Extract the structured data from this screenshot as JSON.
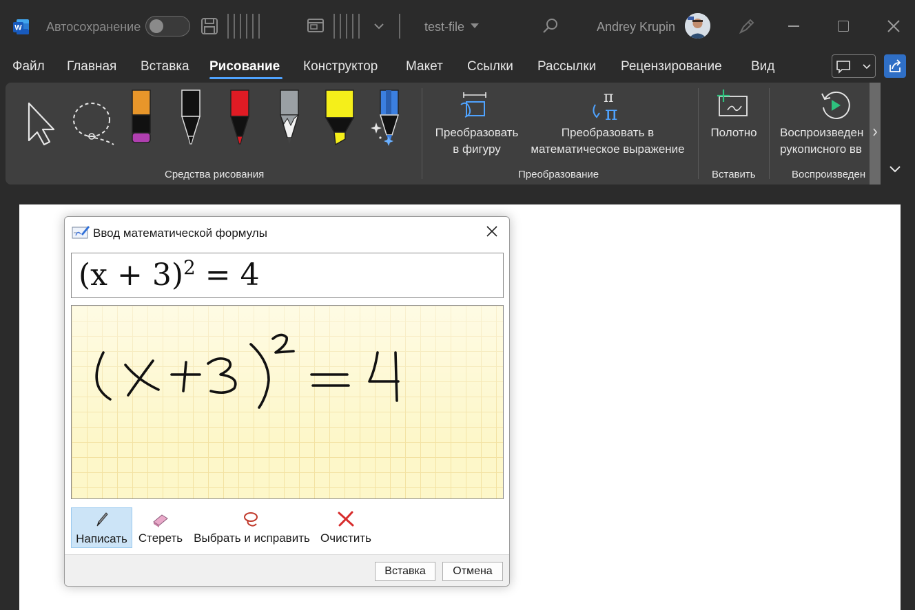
{
  "titlebar": {
    "autosave_label": "Автосохранение",
    "autosave_on": false,
    "filename": "test-file",
    "username": "Andrey Krupin"
  },
  "tabs": [
    {
      "label": "Файл"
    },
    {
      "label": "Главная"
    },
    {
      "label": "Вставка"
    },
    {
      "label": "Рисование",
      "active": true
    },
    {
      "label": "Конструктор"
    },
    {
      "label": "Макет"
    },
    {
      "label": "Ссылки"
    },
    {
      "label": "Рассылки"
    },
    {
      "label": "Рецензирование"
    },
    {
      "label": "Вид"
    }
  ],
  "ribbon": {
    "groups": {
      "drawing_tools": "Средства рисования",
      "convert": "Преобразование",
      "insert": "Вставить",
      "replay": "Воспроизведен"
    },
    "buttons": {
      "to_shape_line1": "Преобразовать",
      "to_shape_line2": "в фигуру",
      "to_math_line1": "Преобразовать в",
      "to_math_line2": "математическое выражение",
      "canvas": "Полотно",
      "replay_line1": "Воспроизведен",
      "replay_line2": "рукописного вв"
    },
    "pens": [
      {
        "name": "orange-pen",
        "color": "#e8962a",
        "tip": "#b03fb0"
      },
      {
        "name": "black-pen",
        "color": "#111111",
        "tip": "#111111"
      },
      {
        "name": "red-pen",
        "color": "#e01b24",
        "tip": "#e01b24"
      },
      {
        "name": "pencil",
        "color": "#9aa0a4",
        "tip": "#444444"
      },
      {
        "name": "yellow-highlighter",
        "color": "#f5ef1a",
        "tip": "#f5ef1a"
      },
      {
        "name": "action-pen",
        "color": "#3b7fe0",
        "tip": "#3b7fe0"
      }
    ],
    "accent": "#4fa3ff"
  },
  "dialog": {
    "title": "Ввод математической формулы",
    "preview": {
      "base": "(x + 3)",
      "exponent": "2",
      "rhs": " = 4"
    },
    "tools": [
      {
        "label": "Написать",
        "active": true
      },
      {
        "label": "Стереть"
      },
      {
        "label": "Выбрать и исправить"
      },
      {
        "label": "Очистить"
      }
    ],
    "buttons": {
      "insert": "Вставка",
      "cancel": "Отмена"
    }
  }
}
